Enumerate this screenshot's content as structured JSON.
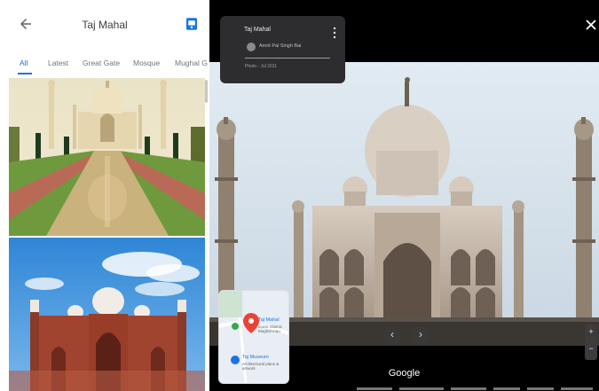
{
  "left_panel": {
    "title": "Taj Mahal",
    "tabs": [
      "All",
      "Latest",
      "Great Gate",
      "Mosque",
      "Mughal G"
    ],
    "active_tab": 0
  },
  "viewer": {
    "info_card": {
      "title": "Taj Mahal",
      "author": "Amrit Pal Singh Bai",
      "date": "Photo - Jul 2011"
    },
    "minimap": {
      "place1": "Taj Mahal",
      "place1_sub": "Iconic Islamic Mughal mau",
      "place2": "Taj Museum",
      "place2_sub": "Architectural plans & artwork"
    },
    "attribution": "Google"
  },
  "colors": {
    "accent": "#1a73e8",
    "viewer_bg": "#000000",
    "card_bg": "#2d2d2f"
  }
}
